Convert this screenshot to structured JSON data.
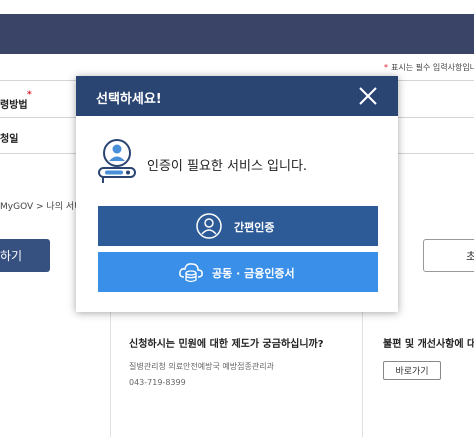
{
  "page": {
    "required_note": "표시는 필수 입력사항입니",
    "form_rows": [
      {
        "label": "령방법",
        "required": true
      },
      {
        "label": "청일",
        "required": false
      }
    ],
    "breadcrumb": "MyGOV > 나의 서비스",
    "apply_button_label": "하기",
    "right_button_label": "초"
  },
  "info": {
    "title": "신청하시는 민원에 대한 제도가 궁금하십니까?",
    "department": "질병관리청 의료안전예방국 예방접종관리과",
    "phone": "043-719-8399"
  },
  "complaint": {
    "title": "불편 및 개선사항에 대",
    "button_label": "바로가기"
  },
  "modal": {
    "title": "선택하세요!",
    "message": "인증이 필요한 서비스 입니다.",
    "buttons": [
      {
        "label": "간편인증",
        "icon": "person-icon",
        "color": "#2d5b97"
      },
      {
        "label": "공동 · 금융인증서",
        "icon": "cloud-database-icon",
        "color": "#3a8fe8"
      }
    ],
    "close_icon": "close-icon"
  },
  "colors": {
    "header": "#3a4466",
    "modal_header": "#2b4573",
    "required_star": "#d9232e"
  }
}
